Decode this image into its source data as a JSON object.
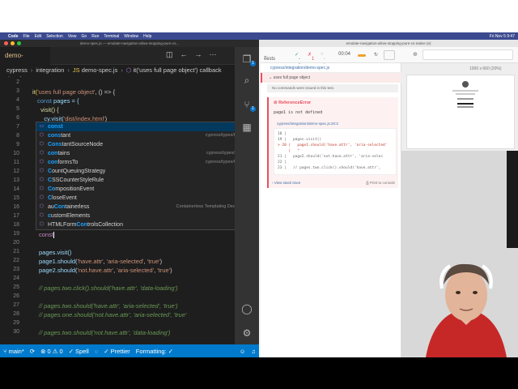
{
  "menubar": {
    "apple": "",
    "app_name": "Code",
    "items": [
      "File",
      "Edit",
      "Selection",
      "View",
      "Go",
      "Run",
      "Terminal",
      "Window",
      "Help"
    ],
    "clock": "Fri Nov 5 9:47"
  },
  "vscode": {
    "window_title": "demo-spec.js — emulate-navigation-allow-stopping-pure-cs...",
    "tab": {
      "name": "demo-spec.js",
      "modified": "U"
    },
    "breadcrumb": [
      "cypress",
      "integration",
      "demo-spec.js",
      "it('uses full page object') callback"
    ],
    "lines": [
      {
        "n": "2"
      },
      {
        "n": "3"
      },
      {
        "n": "4"
      },
      {
        "n": "5"
      },
      {
        "n": "6"
      },
      {
        "n": "7"
      },
      {
        "n": "8"
      },
      {
        "n": "9"
      },
      {
        "n": "10"
      },
      {
        "n": "11"
      },
      {
        "n": "12"
      },
      {
        "n": "13"
      },
      {
        "n": "14"
      },
      {
        "n": "15"
      },
      {
        "n": "16"
      },
      {
        "n": "17"
      },
      {
        "n": "18"
      },
      {
        "n": "19"
      },
      {
        "n": "20"
      },
      {
        "n": "21"
      },
      {
        "n": "22"
      },
      {
        "n": "23"
      },
      {
        "n": "24"
      },
      {
        "n": "25"
      },
      {
        "n": "26"
      },
      {
        "n": "27"
      },
      {
        "n": "28"
      },
      {
        "n": "29"
      },
      {
        "n": "30"
      }
    ],
    "code": {
      "l3_it": "it",
      "l3_str": "'uses full page object'",
      "l3_rest": ", () => {",
      "l4_kw": "const",
      "l4_var": " pages = {",
      "l5": "  visit() {",
      "l6_fn": "    cy.visit(",
      "l6_str": "'dist/index.html'",
      "l6_end": ")",
      "l19": "const",
      "l21": "pages.visit()",
      "l22_a": "page1.should(",
      "l22_b": "'have.attr'",
      "l22_c": ", ",
      "l22_d": "'aria-selected'",
      "l22_e": ", ",
      "l22_f": "'true'",
      "l22_g": ")",
      "l23_a": "page2.should(",
      "l23_b": "'not.have.attr'",
      "l23_c": ", ",
      "l23_d": "'aria-selected'",
      "l23_e": ", ",
      "l23_f": "'true'",
      "l23_g": ")",
      "l25": "// pages.two.click().should('have.attr', 'data-loading')",
      "l27": "// pages.two.should('have.attr', 'aria-selected', 'true')",
      "l28": "// pages.one.should('not.have.attr', 'aria-selected', 'true'",
      "l30": "// pages.two.should('not.have.attr', 'data-loading')"
    },
    "suggestions": [
      {
        "pre": "",
        "hl": "const",
        "post": "",
        "detail": "const"
      },
      {
        "pre": "",
        "hl": "cons",
        "post": "tant",
        "detail": "cypress/types/lodash"
      },
      {
        "pre": "",
        "hl": "Cons",
        "post": "tantSourceNode",
        "detail": ""
      },
      {
        "pre": "",
        "hl": "con",
        "post": "tains",
        "detail": "cypress/types/jquery"
      },
      {
        "pre": "",
        "hl": "con",
        "post": "formsTo",
        "detail": "cypress/types/lodash"
      },
      {
        "pre": "",
        "hl": "C",
        "post": "ountQueuingStrategy",
        "detail": ""
      },
      {
        "pre": "",
        "hl": "C",
        "post": "SSCounterStyleRule",
        "detail": ""
      },
      {
        "pre": "",
        "hl": "Co",
        "post": "mpositionEvent",
        "detail": ""
      },
      {
        "pre": "",
        "hl": "C",
        "post": "loseEvent",
        "detail": ""
      },
      {
        "pre": "au",
        "hl": "Con",
        "post": "tainerless",
        "detail": "Containerless Templating Decorator"
      },
      {
        "pre": "",
        "hl": "c",
        "post": "ustomElements",
        "detail": ""
      },
      {
        "pre": "HTMLForm",
        "hl": "Con",
        "post": "trolsCollection",
        "detail": ""
      }
    ],
    "statusbar": {
      "branch": "main*",
      "sync": "⟳",
      "errors": "⊗ 0 ⚠ 0",
      "spell": "✓ Spell",
      "prettier": "✓ Prettier",
      "formatting": "Formatting: ✓"
    }
  },
  "cypress": {
    "window_title": "emulate-navigation-allow-stopping-pure-cs-native (e)",
    "tests_label": "Tests",
    "passed": "--",
    "failed": "1",
    "pending": "--",
    "timer": "00:04",
    "spec_path": "cypress/integration/demo-spec.js",
    "test_title": "uses full page object",
    "no_commands": "No commands were issued in this test.",
    "error_name": "ReferenceError",
    "error_msg": "page1 is not defined",
    "error_loc": "cypress/integration/demo-spec.js:20:3",
    "frame_lines": [
      "18 |",
      "19 |   pages.visit()",
      "> 20 |   page1.should('have.attr', 'aria-selected'",
      "     |   ^",
      "21 |   page2.should('not.have.attr', 'aria-selec",
      "22 |",
      "23 |   // pages.two.click().should('have.attr',"
    ],
    "view_stack": "View stack trace",
    "print_console": "Print to console",
    "viewport": "1000 x 660",
    "zoom": "(20%)"
  }
}
